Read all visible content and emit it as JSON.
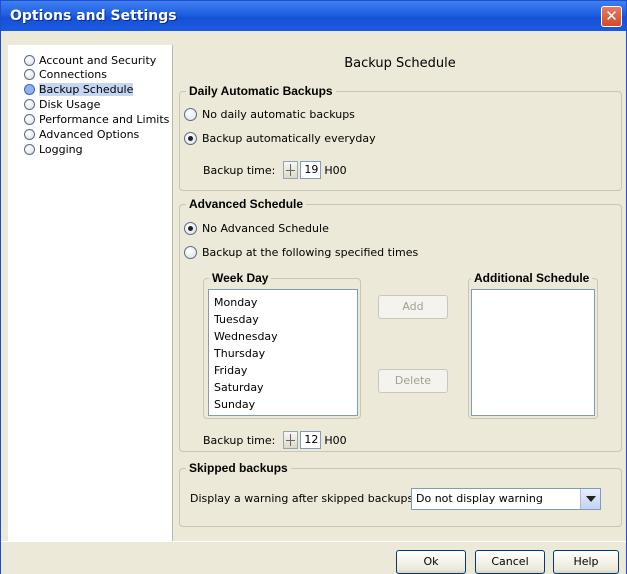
{
  "window": {
    "title": "Options and Settings"
  },
  "sidebar": {
    "items": [
      {
        "label": "Account and Security",
        "selected": false
      },
      {
        "label": "Connections",
        "selected": false
      },
      {
        "label": "Backup Schedule",
        "selected": true
      },
      {
        "label": "Disk Usage",
        "selected": false
      },
      {
        "label": "Performance and Limits",
        "selected": false
      },
      {
        "label": "Advanced Options",
        "selected": false
      },
      {
        "label": "Logging",
        "selected": false
      }
    ]
  },
  "main": {
    "title": "Backup Schedule",
    "daily": {
      "group_title": "Daily Automatic Backups",
      "option_none": "No daily automatic backups",
      "option_everyday": "Backup automatically everyday",
      "selected": "everyday",
      "time_label": "Backup time:",
      "time_value": "19",
      "time_suffix": "H00"
    },
    "advanced": {
      "group_title": "Advanced Schedule",
      "option_none": "No Advanced Schedule",
      "option_specified": "Backup at the following specified times",
      "selected": "none",
      "weekday_title": "Week Day",
      "weekdays": [
        "Monday",
        "Tuesday",
        "Wednesday",
        "Thursday",
        "Friday",
        "Saturday",
        "Sunday"
      ],
      "add_label": "Add",
      "delete_label": "Delete",
      "additional_title": "Additional Schedule",
      "time_label": "Backup time:",
      "time_value": "12",
      "time_suffix": "H00"
    },
    "skipped": {
      "group_title": "Skipped backups",
      "warning_label": "Display a warning after skipped backups:",
      "warning_value": "Do not display warning"
    }
  },
  "footer": {
    "ok_label": "Ok",
    "cancel_label": "Cancel",
    "help_label": "Help"
  }
}
